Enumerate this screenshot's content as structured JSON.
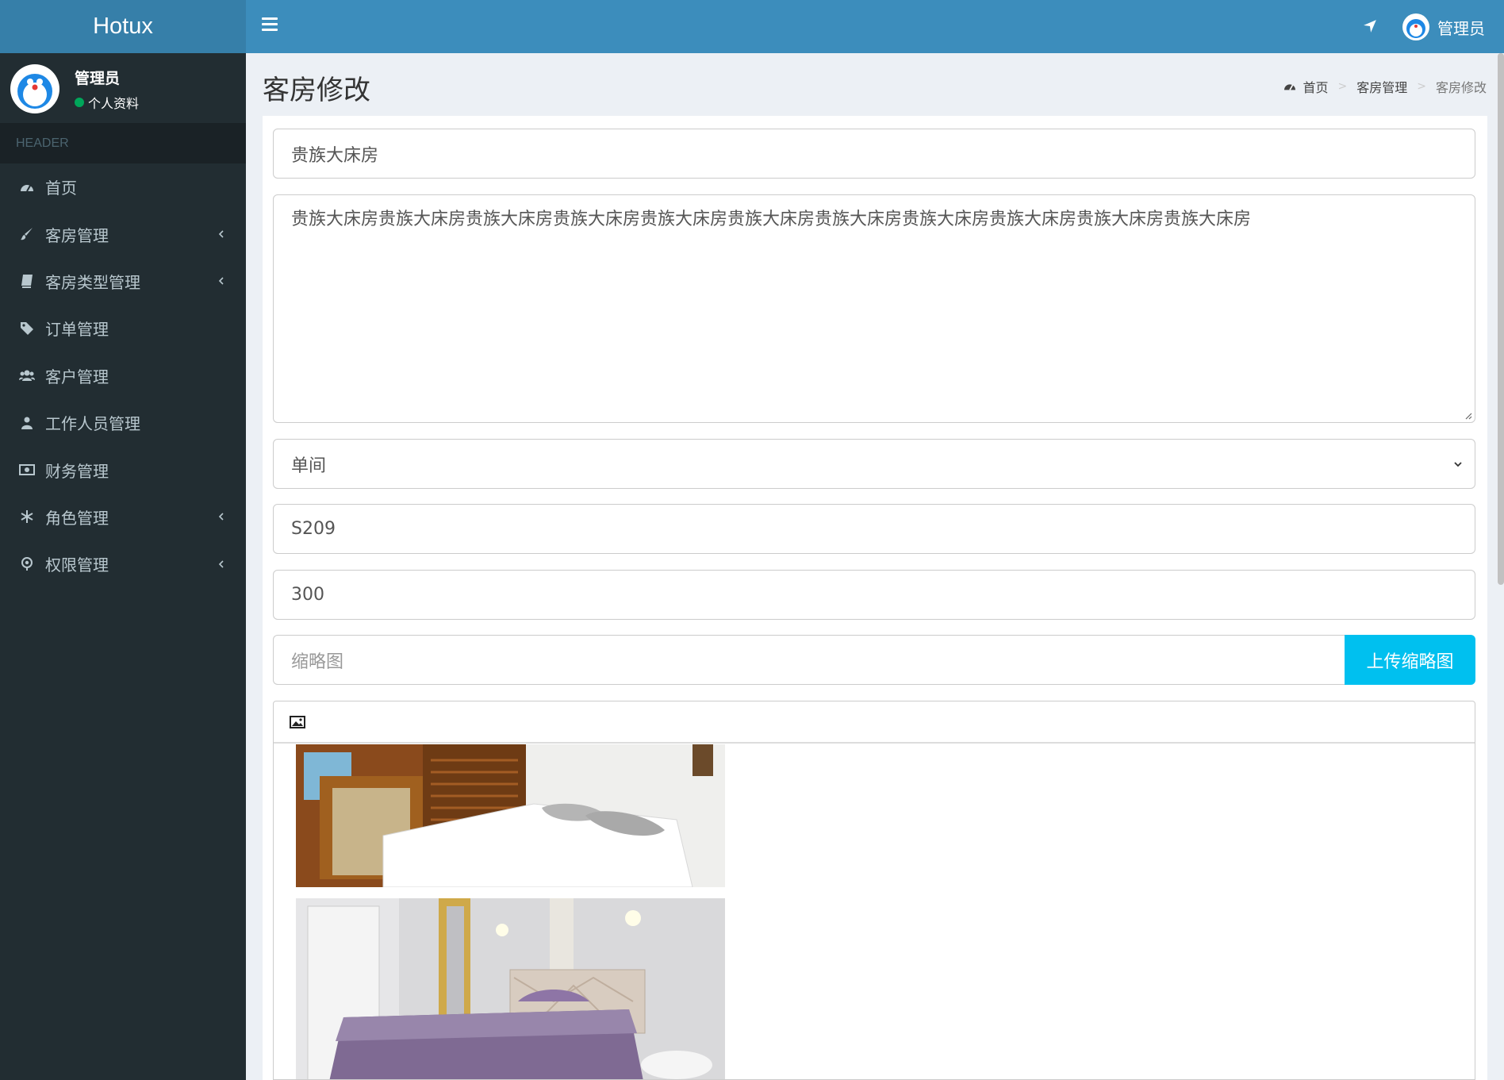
{
  "app": {
    "logo": "Hotux"
  },
  "navbar": {
    "user_name": "管理员"
  },
  "user_panel": {
    "name": "管理员",
    "status": "个人资料"
  },
  "sidebar": {
    "header": "HEADER",
    "items": [
      {
        "label": "首页",
        "icon": "dashboard-icon",
        "has_children": false
      },
      {
        "label": "客房管理",
        "icon": "brush-icon",
        "has_children": true
      },
      {
        "label": "客房类型管理",
        "icon": "book-icon",
        "has_children": true
      },
      {
        "label": "订单管理",
        "icon": "tag-icon",
        "has_children": false
      },
      {
        "label": "客户管理",
        "icon": "users-icon",
        "has_children": false
      },
      {
        "label": "工作人员管理",
        "icon": "user-icon",
        "has_children": false
      },
      {
        "label": "财务管理",
        "icon": "money-icon",
        "has_children": false
      },
      {
        "label": "角色管理",
        "icon": "snowflake-icon",
        "has_children": true
      },
      {
        "label": "权限管理",
        "icon": "map-pin-icon",
        "has_children": true
      }
    ]
  },
  "page": {
    "title": "客房修改"
  },
  "breadcrumb": {
    "home": "首页",
    "section": "客房管理",
    "current": "客房修改"
  },
  "form": {
    "name": "贵族大床房",
    "description": "贵族大床房贵族大床房贵族大床房贵族大床房贵族大床房贵族大床房贵族大床房贵族大床房贵族大床房贵族大床房贵族大床房",
    "room_type": "单间",
    "room_number": "S209",
    "price": "300",
    "thumbnail_placeholder": "缩略图",
    "upload_label": "上传缩略图"
  },
  "colors": {
    "header": "#3c8dbc",
    "logo_bg": "#367fa9",
    "sidebar": "#222d32",
    "upload_btn": "#00c0ef"
  }
}
